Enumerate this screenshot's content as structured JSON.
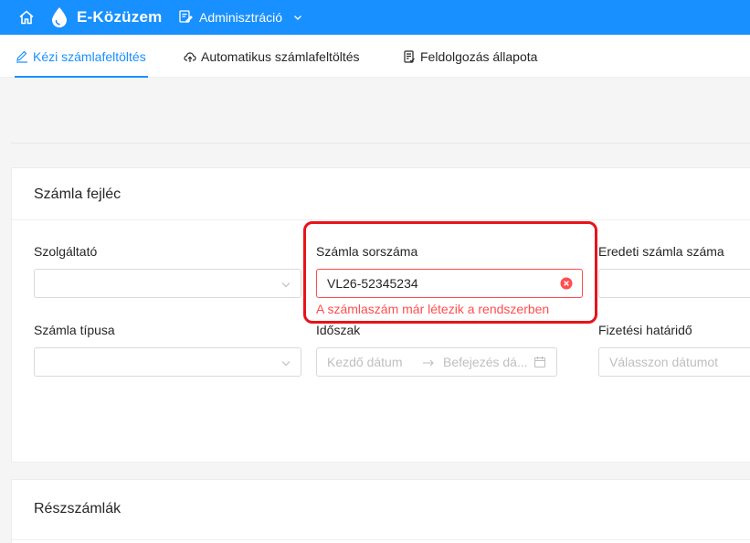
{
  "header": {
    "brand": "E-Közüzem",
    "admin_menu": "Adminisztráció"
  },
  "tabs": [
    {
      "label": "Kézi számlafeltöltés",
      "active": true
    },
    {
      "label": "Automatikus számlafeltöltés",
      "active": false
    },
    {
      "label": "Feldolgozás állapota",
      "active": false
    }
  ],
  "section_header": {
    "title": "Számla fejléc",
    "fields": {
      "provider": {
        "label": "Szolgáltató",
        "value": ""
      },
      "invoice_number": {
        "label": "Számla sorszáma",
        "value": "VL26-52345234",
        "error": "A számlaszám már létezik a rendszerben"
      },
      "original_invoice": {
        "label": "Eredeti számla száma",
        "value": ""
      },
      "invoice_type": {
        "label": "Számla típusa",
        "value": ""
      },
      "period": {
        "label": "Időszak",
        "start_placeholder": "Kezdő dátum",
        "end_placeholder": "Befejezés dá..."
      },
      "due_date": {
        "label": "Fizetési határidő",
        "placeholder": "Válasszon dátumot"
      }
    }
  },
  "section_items": {
    "title": "Részszámlák"
  },
  "colors": {
    "primary": "#1890ff",
    "error": "#ff4d4f",
    "highlight": "#e8131a"
  }
}
